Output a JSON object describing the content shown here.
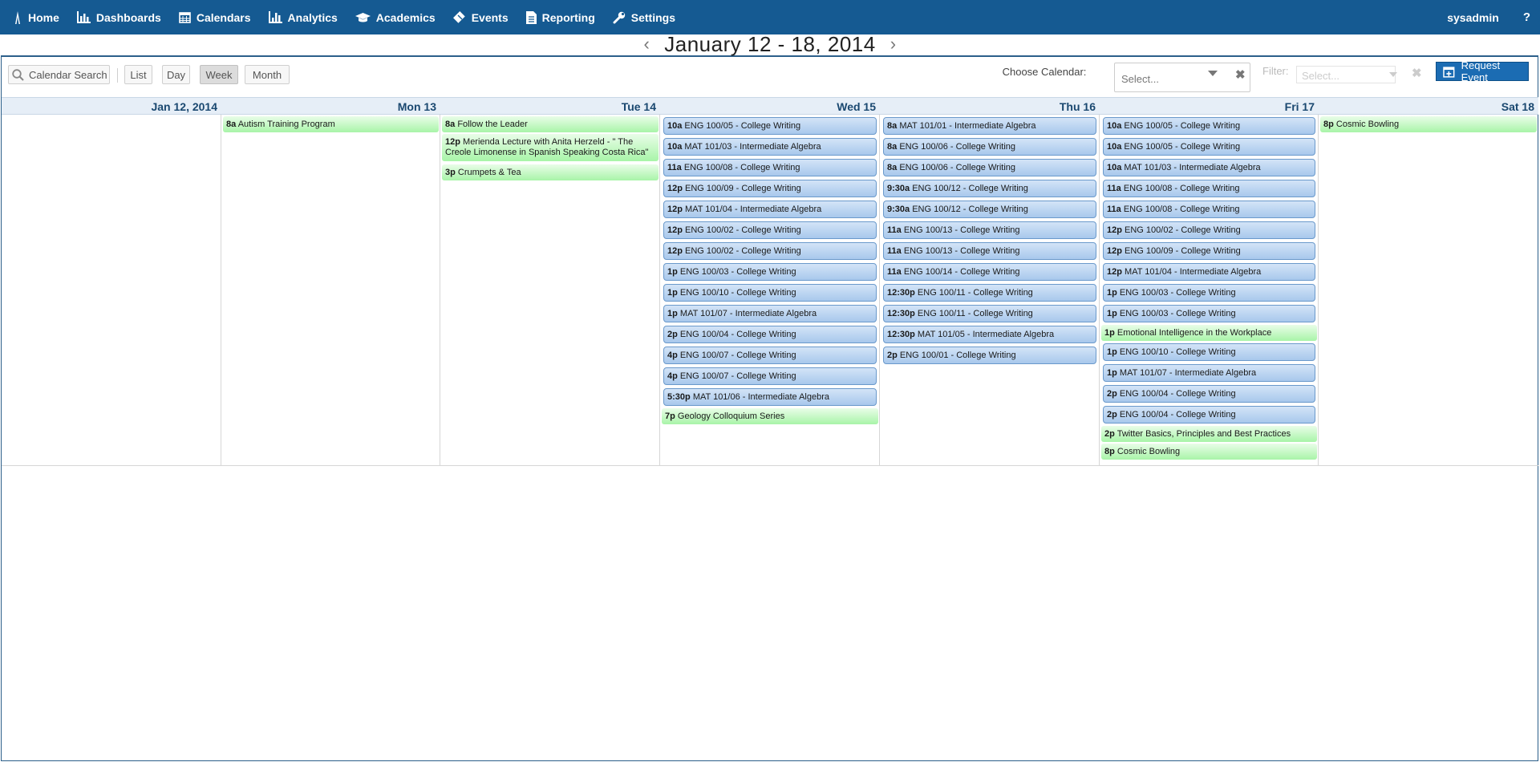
{
  "nav": {
    "items": [
      {
        "label": "Home",
        "icon": "home-icon"
      },
      {
        "label": "Dashboards",
        "icon": "bar-chart-icon"
      },
      {
        "label": "Calendars",
        "icon": "calendar-icon"
      },
      {
        "label": "Analytics",
        "icon": "analytics-icon"
      },
      {
        "label": "Academics",
        "icon": "graduation-cap-icon"
      },
      {
        "label": "Events",
        "icon": "ticket-icon"
      },
      {
        "label": "Reporting",
        "icon": "document-icon"
      },
      {
        "label": "Settings",
        "icon": "wrench-icon"
      }
    ],
    "user": "sysadmin",
    "help": "?"
  },
  "header": {
    "title": "January 12 - 18, 2014",
    "prev": "‹",
    "next": "›"
  },
  "toolbar": {
    "search_label": "Calendar Search",
    "views": [
      "List",
      "Day",
      "Week",
      "Month"
    ],
    "active_view": "Week",
    "choose_calendar_label": "Choose Calendar:",
    "choose_calendar_placeholder": "Select...",
    "filter_label": "Filter:",
    "filter_placeholder": "Select...",
    "request_event_label": "Request Event"
  },
  "days": [
    {
      "label": "Jan 12, 2014",
      "events": []
    },
    {
      "label": "Mon 13",
      "events": [
        {
          "time": "8a",
          "title": "Autism Training Program",
          "type": "green"
        }
      ]
    },
    {
      "label": "Tue 14",
      "events": [
        {
          "time": "8a",
          "title": "Follow the Leader",
          "type": "green"
        },
        {
          "time": "12p",
          "title": "Merienda Lecture with Anita Herzeld - \" The Creole Limonense in Spanish Speaking Costa Rica\"",
          "type": "green-tall"
        },
        {
          "time": "3p",
          "title": "Crumpets & Tea",
          "type": "green"
        }
      ]
    },
    {
      "label": "Wed 15",
      "events": [
        {
          "time": "10a",
          "title": "ENG 100/05 - College Writing",
          "type": "blue"
        },
        {
          "time": "10a",
          "title": "MAT 101/03 - Intermediate Algebra",
          "type": "blue"
        },
        {
          "time": "11a",
          "title": "ENG 100/08 - College Writing",
          "type": "blue"
        },
        {
          "time": "12p",
          "title": "ENG 100/09 - College Writing",
          "type": "blue"
        },
        {
          "time": "12p",
          "title": "MAT 101/04 - Intermediate Algebra",
          "type": "blue"
        },
        {
          "time": "12p",
          "title": "ENG 100/02 - College Writing",
          "type": "blue"
        },
        {
          "time": "12p",
          "title": "ENG 100/02 - College Writing",
          "type": "blue"
        },
        {
          "time": "1p",
          "title": "ENG 100/03 - College Writing",
          "type": "blue"
        },
        {
          "time": "1p",
          "title": "ENG 100/10 - College Writing",
          "type": "blue"
        },
        {
          "time": "1p",
          "title": "MAT 101/07 - Intermediate Algebra",
          "type": "blue"
        },
        {
          "time": "2p",
          "title": "ENG 100/04 - College Writing",
          "type": "blue"
        },
        {
          "time": "4p",
          "title": "ENG 100/07 - College Writing",
          "type": "blue"
        },
        {
          "time": "4p",
          "title": "ENG 100/07 - College Writing",
          "type": "blue"
        },
        {
          "time": "5:30p",
          "title": "MAT 101/06 - Intermediate Algebra",
          "type": "blue"
        },
        {
          "time": "7p",
          "title": "Geology Colloquium Series",
          "type": "green"
        }
      ]
    },
    {
      "label": "Thu 16",
      "events": [
        {
          "time": "8a",
          "title": "MAT 101/01 - Intermediate Algebra",
          "type": "blue"
        },
        {
          "time": "8a",
          "title": "ENG 100/06 - College Writing",
          "type": "blue"
        },
        {
          "time": "8a",
          "title": "ENG 100/06 - College Writing",
          "type": "blue"
        },
        {
          "time": "9:30a",
          "title": "ENG 100/12 - College Writing",
          "type": "blue"
        },
        {
          "time": "9:30a",
          "title": "ENG 100/12 - College Writing",
          "type": "blue"
        },
        {
          "time": "11a",
          "title": "ENG 100/13 - College Writing",
          "type": "blue"
        },
        {
          "time": "11a",
          "title": "ENG 100/13 - College Writing",
          "type": "blue"
        },
        {
          "time": "11a",
          "title": "ENG 100/14 - College Writing",
          "type": "blue"
        },
        {
          "time": "12:30p",
          "title": "ENG 100/11 - College Writing",
          "type": "blue"
        },
        {
          "time": "12:30p",
          "title": "ENG 100/11 - College Writing",
          "type": "blue"
        },
        {
          "time": "12:30p",
          "title": "MAT 101/05 - Intermediate Algebra",
          "type": "blue"
        },
        {
          "time": "2p",
          "title": "ENG 100/01 - College Writing",
          "type": "blue"
        }
      ]
    },
    {
      "label": "Fri 17",
      "events": [
        {
          "time": "10a",
          "title": "ENG 100/05 - College Writing",
          "type": "blue"
        },
        {
          "time": "10a",
          "title": "ENG 100/05 - College Writing",
          "type": "blue"
        },
        {
          "time": "10a",
          "title": "MAT 101/03 - Intermediate Algebra",
          "type": "blue"
        },
        {
          "time": "11a",
          "title": "ENG 100/08 - College Writing",
          "type": "blue"
        },
        {
          "time": "11a",
          "title": "ENG 100/08 - College Writing",
          "type": "blue"
        },
        {
          "time": "12p",
          "title": "ENG 100/02 - College Writing",
          "type": "blue"
        },
        {
          "time": "12p",
          "title": "ENG 100/09 - College Writing",
          "type": "blue"
        },
        {
          "time": "12p",
          "title": "MAT 101/04 - Intermediate Algebra",
          "type": "blue"
        },
        {
          "time": "1p",
          "title": "ENG 100/03 - College Writing",
          "type": "blue"
        },
        {
          "time": "1p",
          "title": "ENG 100/03 - College Writing",
          "type": "blue"
        },
        {
          "time": "1p",
          "title": "Emotional Intelligence in the Workplace",
          "type": "green"
        },
        {
          "time": "1p",
          "title": "ENG 100/10 - College Writing",
          "type": "blue"
        },
        {
          "time": "1p",
          "title": "MAT 101/07 - Intermediate Algebra",
          "type": "blue"
        },
        {
          "time": "2p",
          "title": "ENG 100/04 - College Writing",
          "type": "blue"
        },
        {
          "time": "2p",
          "title": "ENG 100/04 - College Writing",
          "type": "blue"
        },
        {
          "time": "2p",
          "title": "Twitter Basics, Principles and Best Practices",
          "type": "green"
        },
        {
          "time": "8p",
          "title": "Cosmic Bowling",
          "type": "green"
        }
      ]
    },
    {
      "label": "Sat 18",
      "events": [
        {
          "time": "8p",
          "title": "Cosmic Bowling",
          "type": "green"
        }
      ]
    }
  ]
}
